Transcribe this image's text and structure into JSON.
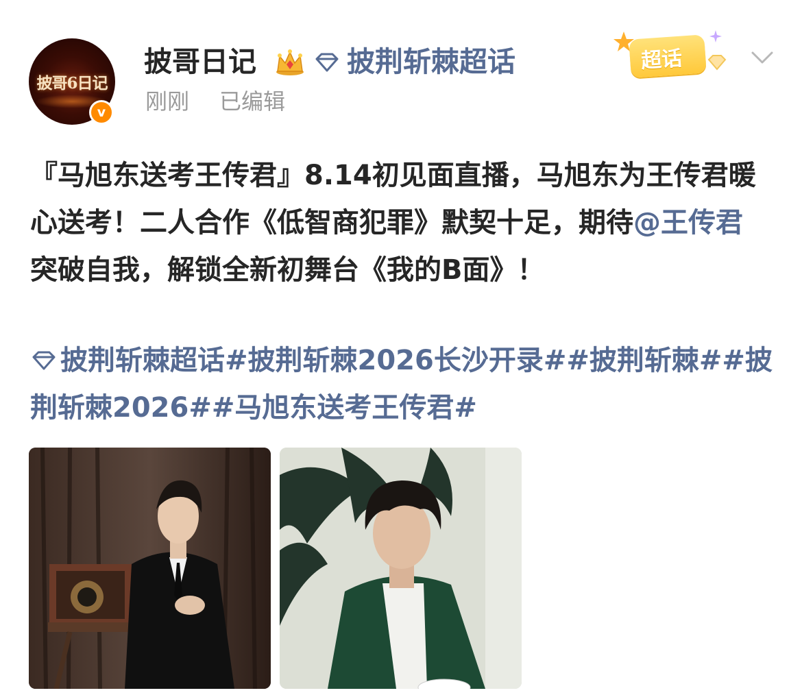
{
  "post": {
    "username": "披哥日记",
    "avatar_text": "披哥6日记",
    "header_topic": "披荆斩棘超话",
    "time": "刚刚",
    "edited": "已编辑",
    "badge_text": "超话",
    "verified_mark": "v",
    "text": {
      "seg1": "『马旭东送考王传君』8.14初见面直播，马旭东为王传君暖心送考！二人合作《低智商犯罪》默契十足，期待",
      "mention": "@王传君",
      "seg2": " 突破自我，解锁全新初舞台《我的B面》！"
    },
    "tags": "披荆斩棘超话#披荆斩棘2026长沙开录##披荆斩棘##披荆斩棘2026##马旭东送考王传君#",
    "photos": [
      "photo-1",
      "photo-2"
    ]
  },
  "colors": {
    "link": "#566b93",
    "text": "#262626",
    "meta": "#9a9a9a",
    "verified": "#ff8a00"
  }
}
